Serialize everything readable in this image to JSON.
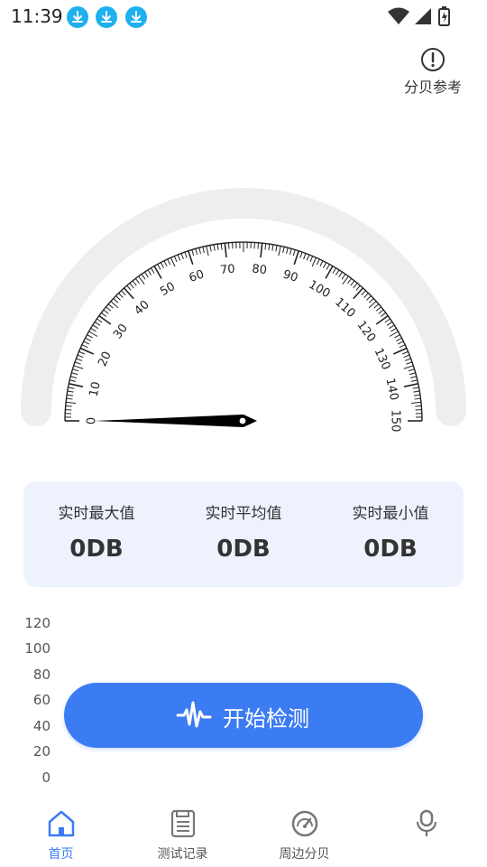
{
  "status_bar": {
    "time": "11:39",
    "download_icons": [
      "download-icon",
      "download-icon",
      "download-icon"
    ],
    "icons": [
      "wifi-icon",
      "signal-icon",
      "battery-icon"
    ]
  },
  "header": {
    "reference_label": "分贝参考",
    "reference_icon": "info-circle-icon"
  },
  "gauge": {
    "scale_min": 0,
    "scale_max": 150,
    "major_step": 10,
    "minor_step": 1,
    "tick_labels": [
      "0",
      "10",
      "20",
      "30",
      "40",
      "50",
      "60",
      "70",
      "80",
      "90",
      "100",
      "110",
      "120",
      "130",
      "140",
      "150"
    ],
    "current_value": 0
  },
  "stats": {
    "max": {
      "label": "实时最大值",
      "value": "0DB"
    },
    "avg": {
      "label": "实时平均值",
      "value": "0DB"
    },
    "min": {
      "label": "实时最小值",
      "value": "0DB"
    }
  },
  "chart": {
    "y_ticks": [
      "120",
      "100",
      "80",
      "60",
      "40",
      "20",
      "0"
    ]
  },
  "start_button": {
    "label": "开始检测",
    "icon": "waveform-icon"
  },
  "bottom_nav": {
    "items": [
      {
        "label": "首页",
        "icon": "home-icon",
        "active": true
      },
      {
        "label": "测试记录",
        "icon": "save-list-icon",
        "active": false
      },
      {
        "label": "周边分贝",
        "icon": "speedometer-icon",
        "active": false
      },
      {
        "label": "",
        "icon": "microphone-icon",
        "active": false
      }
    ]
  },
  "colors": {
    "accent": "#3c7cf3",
    "card_bg": "#edf2fd",
    "gauge_track": "#eeeeee",
    "download_badge": "#1fb0ef"
  }
}
